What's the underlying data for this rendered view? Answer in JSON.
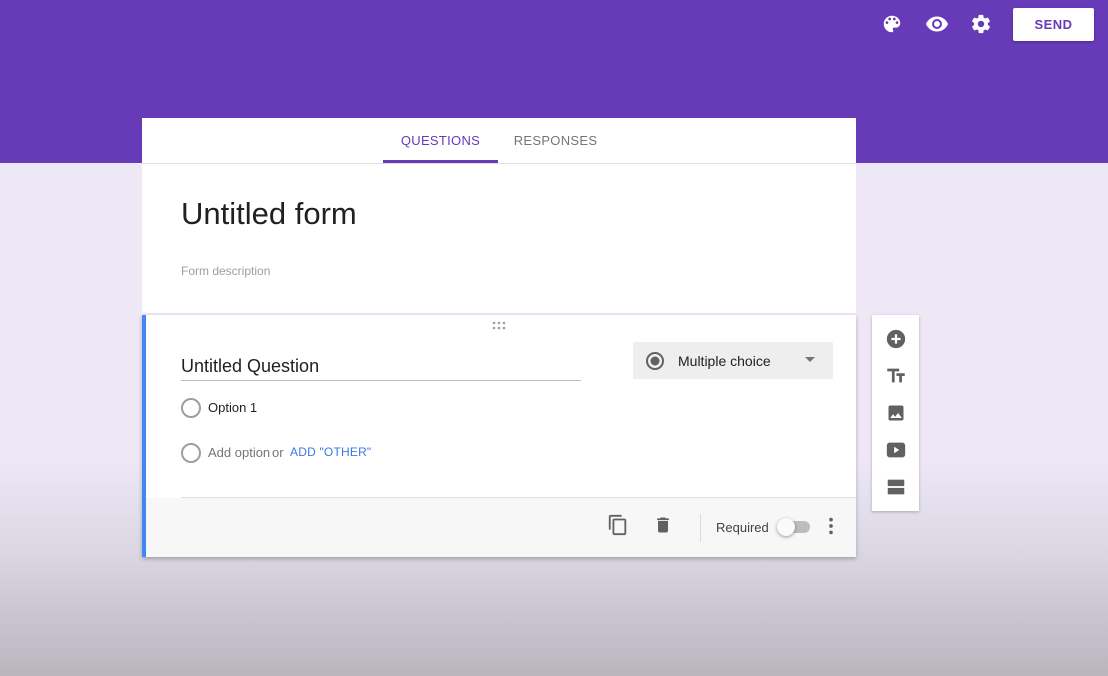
{
  "header": {
    "icons": [
      "palette-icon",
      "eye-icon",
      "gear-icon"
    ],
    "send_label": "SEND"
  },
  "tabs": [
    {
      "label": "QUESTIONS",
      "active": true
    },
    {
      "label": "RESPONSES",
      "active": false
    }
  ],
  "form": {
    "title": "Untitled form",
    "description_placeholder": "Form description"
  },
  "question": {
    "title": "Untitled Question",
    "type": "Multiple choice",
    "options": [
      "Option 1"
    ],
    "add_option": "Add option",
    "or": "or",
    "add_other": "ADD \"OTHER\"",
    "required_label": "Required",
    "required": false
  },
  "side_toolbar": {
    "icons": [
      "add-question-icon",
      "title-text-icon",
      "image-icon",
      "video-icon",
      "section-icon"
    ]
  },
  "colors": {
    "primary": "#673ab7",
    "accent": "#4285f4",
    "link": "#3b78e7"
  }
}
